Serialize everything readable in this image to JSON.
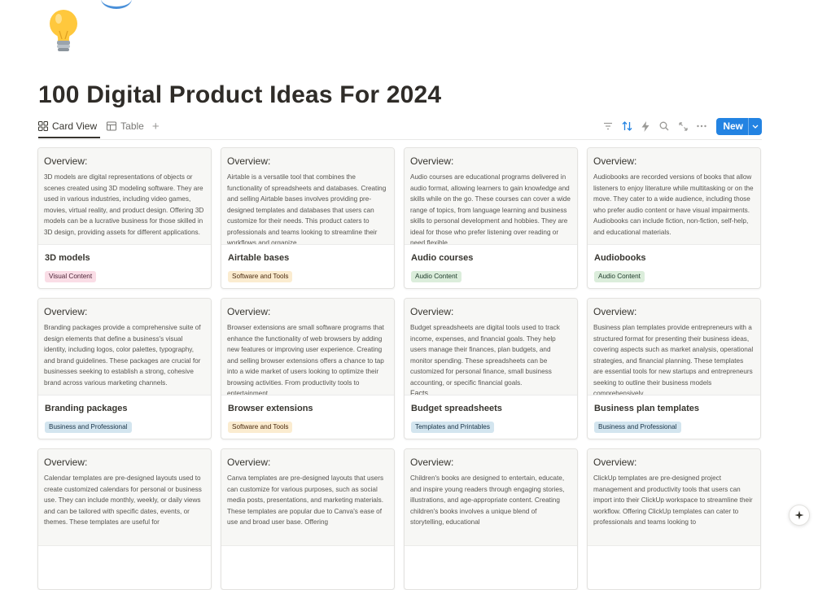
{
  "page": {
    "title": "100 Digital Product Ideas For 2024",
    "icon": "lightbulb-icon"
  },
  "tabs": [
    {
      "label": "Card View",
      "icon": "grid-icon",
      "active": true
    },
    {
      "label": "Table",
      "icon": "table-icon",
      "active": false
    }
  ],
  "toolbar": {
    "icons": [
      "filter-icon",
      "sort-icon",
      "automation-icon",
      "search-icon",
      "expand-icon",
      "more-icon"
    ],
    "new_label": "New"
  },
  "tag_colors": {
    "Visual Content": {
      "bg": "#fadde6",
      "fg": "#4c2337"
    },
    "Software and Tools": {
      "bg": "#fbecd0",
      "fg": "#49290e"
    },
    "Audio Content": {
      "bg": "#dbeddb",
      "fg": "#1c3829"
    },
    "Business and Professional": {
      "bg": "#d3e5ef",
      "fg": "#183347"
    },
    "Templates and Printables": {
      "bg": "#d3e5ef",
      "fg": "#183347"
    }
  },
  "cards": [
    {
      "heading": "Overview:",
      "text": "3D models are digital representations of objects or scenes created using 3D modeling software. They are used in various industries, including video games, movies, virtual reality, and product design. Offering 3D models can be a lucrative business for those skilled in 3D design, providing assets for different applications.",
      "extra": "",
      "title": "3D models",
      "tag": "Visual Content"
    },
    {
      "heading": "Overview:",
      "text": "Airtable is a versatile tool that combines the functionality of spreadsheets and databases. Creating and selling Airtable bases involves providing pre-designed templates and databases that users can customize for their needs. This product caters to professionals and teams looking to streamline their workflows and organize",
      "extra": "",
      "title": "Airtable bases",
      "tag": "Software and Tools"
    },
    {
      "heading": "Overview:",
      "text": "Audio courses are educational programs delivered in audio format, allowing learners to gain knowledge and skills while on the go. These courses can cover a wide range of topics, from language learning and business skills to personal development and hobbies. They are ideal for those who prefer listening over reading or need flexible",
      "extra": "",
      "title": "Audio courses",
      "tag": "Audio Content"
    },
    {
      "heading": "Overview:",
      "text": "Audiobooks are recorded versions of books that allow listeners to enjoy literature while multitasking or on the move. They cater to a wide audience, including those who prefer audio content or have visual impairments. Audiobooks can include fiction, non-fiction, self-help, and educational materials.",
      "extra": "",
      "title": "Audiobooks",
      "tag": "Audio Content"
    },
    {
      "heading": "Overview:",
      "text": "Branding packages provide a comprehensive suite of design elements that define a business's visual identity, including logos, color palettes, typography, and brand guidelines. These packages are crucial for businesses seeking to establish a strong, cohesive brand across various marketing channels.",
      "extra": "",
      "title": "Branding packages",
      "tag": "Business and Professional"
    },
    {
      "heading": "Overview:",
      "text": "Browser extensions are small software programs that enhance the functionality of web browsers by adding new features or improving user experience. Creating and selling browser extensions offers a chance to tap into a wide market of users looking to optimize their browsing activities. From productivity tools to entertainment",
      "extra": "",
      "title": "Browser extensions",
      "tag": "Software and Tools"
    },
    {
      "heading": "Overview:",
      "text": "Budget spreadsheets are digital tools used to track income, expenses, and financial goals. They help users manage their finances, plan budgets, and monitor spending. These spreadsheets can be customized for personal finance, small business accounting, or specific financial goals.",
      "extra": "Facts",
      "title": "Budget spreadsheets",
      "tag": "Templates and Printables"
    },
    {
      "heading": "Overview:",
      "text": "Business plan templates provide entrepreneurs with a structured format for presenting their business ideas, covering aspects such as market analysis, operational strategies, and financial planning. These templates are essential tools for new startups and entrepreneurs seeking to outline their business models comprehensively.",
      "extra": "",
      "title": "Business plan templates",
      "tag": "Business and Professional"
    },
    {
      "heading": "Overview:",
      "text": "Calendar templates are pre-designed layouts used to create customized calendars for personal or business use. They can include monthly, weekly, or daily views and can be tailored with specific dates, events, or themes. These templates are useful for",
      "extra": "",
      "title": "",
      "tag": ""
    },
    {
      "heading": "Overview:",
      "text": "Canva templates are pre-designed layouts that users can customize for various purposes, such as social media posts, presentations, and marketing materials. These templates are popular due to Canva's ease of use and broad user base. Offering",
      "extra": "",
      "title": "",
      "tag": ""
    },
    {
      "heading": "Overview:",
      "text": "Children's books are designed to entertain, educate, and inspire young readers through engaging stories, illustrations, and age-appropriate content. Creating children's books involves a unique blend of storytelling, educational",
      "extra": "",
      "title": "",
      "tag": ""
    },
    {
      "heading": "Overview:",
      "text": "ClickUp templates are pre-designed project management and productivity tools that users can import into their ClickUp workspace to streamline their workflow. Offering ClickUp templates can cater to professionals and teams looking to",
      "extra": "",
      "title": "",
      "tag": ""
    }
  ],
  "help": {
    "icon": "sparkle-help-icon"
  }
}
